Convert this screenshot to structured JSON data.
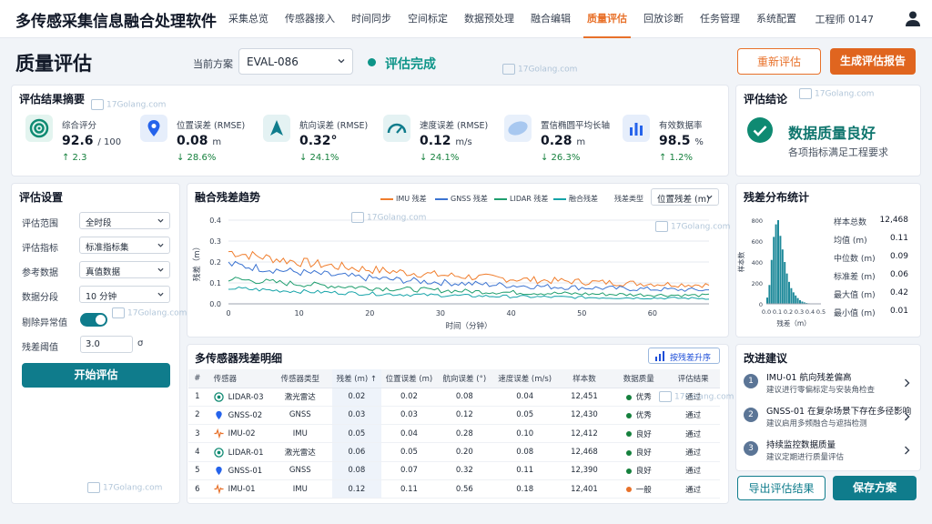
{
  "app": {
    "title": "多传感采集信息融合处理软件",
    "user": "工程师 0147"
  },
  "nav": [
    "采集总览",
    "传感器接入",
    "时间同步",
    "空间标定",
    "数据预处理",
    "融合编辑",
    "质量评估",
    "回放诊断",
    "任务管理",
    "系统配置"
  ],
  "header": {
    "page_title": "质量评估",
    "scheme_label": "当前方案",
    "scheme_value": "EVAL-086",
    "status": "评估完成",
    "reeval_label": "重新评估",
    "report_label": "生成评估报告"
  },
  "summary": {
    "title": "评估结果摘要",
    "metrics": [
      {
        "icon": "target-icon",
        "label": "综合评分",
        "value": "92.6",
        "unit": "/ 100",
        "change": "↑ 2.3"
      },
      {
        "icon": "location-pin-icon",
        "label": "位置误差 (RMSE)",
        "value": "0.08",
        "unit": "m",
        "change": "↓ 28.6%"
      },
      {
        "icon": "heading-arrow-icon",
        "label": "航向误差 (RMSE)",
        "value": "0.32°",
        "unit": "",
        "change": "↓ 24.1%"
      },
      {
        "icon": "speedometer-icon",
        "label": "速度误差 (RMSE)",
        "value": "0.12",
        "unit": "m/s",
        "change": "↓ 24.1%"
      },
      {
        "icon": "ellipse-icon",
        "label": "置信椭圆平均长轴",
        "value": "0.28",
        "unit": "m",
        "change": "↓ 26.3%"
      },
      {
        "icon": "bar-chart-icon",
        "label": "有效数据率",
        "value": "98.5",
        "unit": "%",
        "change": "↑ 1.2%"
      }
    ]
  },
  "conclusion": {
    "title": "评估结论",
    "result": "数据质量良好",
    "detail": "各项指标满足工程要求"
  },
  "settings": {
    "title": "评估设置",
    "fields": [
      {
        "label": "评估范围",
        "value": "全时段"
      },
      {
        "label": "评估指标",
        "value": "标准指标集"
      },
      {
        "label": "参考数据",
        "value": "真值数据"
      },
      {
        "label": "数据分段",
        "value": "10 分钟"
      }
    ],
    "outlier_label": "剔除异常值",
    "threshold_label": "残差阈值",
    "threshold_value": "3.0",
    "threshold_unit": "σ",
    "start_label": "开始评估"
  },
  "trend": {
    "title": "融合残差趋势",
    "residual_type_label": "残差类型",
    "residual_type_value": "位置残差 (m)"
  },
  "chart_data": [
    {
      "type": "line",
      "title": "融合残差趋势",
      "xlabel": "时间（分钟）",
      "ylabel": "残差（m）",
      "xlim": [
        0,
        68
      ],
      "ylim": [
        0,
        0.4
      ],
      "x_ticks": [
        "0",
        "10",
        "20",
        "30",
        "40",
        "50",
        "60"
      ],
      "y_ticks": [
        "0.0",
        "0.1",
        "0.2",
        "0.3",
        "0.4"
      ],
      "series": [
        {
          "name": "IMU 残差",
          "color": "#f07d2c",
          "start": 0.25,
          "end": 0.07,
          "noise": 0.025
        },
        {
          "name": "GNSS 残差",
          "color": "#3b73d1",
          "start": 0.19,
          "end": 0.05,
          "noise": 0.02
        },
        {
          "name": "LIDAR 残差",
          "color": "#1f9e6e",
          "start": 0.12,
          "end": 0.03,
          "noise": 0.015
        },
        {
          "name": "融合残差",
          "color": "#14a3a8",
          "start": 0.075,
          "end": 0.02,
          "noise": 0.01
        }
      ]
    },
    {
      "type": "bar",
      "title": "残差分布统计",
      "xlabel": "残差（m）",
      "ylabel": "样本数",
      "x_ticks": [
        "0.0",
        "0.1",
        "0.2",
        "0.3",
        "0.4",
        "0.5"
      ],
      "y_ticks": [
        "0",
        "200",
        "400",
        "600",
        "800"
      ],
      "bin_width": 0.02,
      "bin_start": 0.0,
      "values": [
        60,
        180,
        420,
        640,
        760,
        800,
        650,
        520,
        400,
        290,
        210,
        150,
        110,
        80,
        55,
        35,
        22,
        14,
        8,
        5,
        3
      ]
    }
  ],
  "distribution": {
    "title": "残差分布统计",
    "stats": [
      {
        "k": "样本总数",
        "v": "12,468"
      },
      {
        "k": "均值 (m)",
        "v": "0.11"
      },
      {
        "k": "中位数 (m)",
        "v": "0.09"
      },
      {
        "k": "标准差 (m)",
        "v": "0.06"
      },
      {
        "k": "最大值 (m)",
        "v": "0.42"
      },
      {
        "k": "最小值 (m)",
        "v": "0.01"
      }
    ]
  },
  "detail": {
    "title": "多传感器残差明细",
    "sort_label": "按残差升序",
    "headers": [
      "#",
      "传感器",
      "传感器类型",
      "残差 (m) ↑",
      "位置误差 (m)",
      "航向误差 (°)",
      "速度误差 (m/s)",
      "样本数",
      "数据质量",
      "评估结果"
    ],
    "rows": [
      {
        "n": "1",
        "icon": "lidar-icon",
        "sensor": "LIDAR-03",
        "type": "激光雷达",
        "res": "0.02",
        "pos": "0.02",
        "hdg": "0.08",
        "spd": "0.04",
        "cnt": "12,451",
        "q": "优秀",
        "qc": "#15803d",
        "r": "通过"
      },
      {
        "n": "2",
        "icon": "gnss-icon",
        "sensor": "GNSS-02",
        "type": "GNSS",
        "res": "0.03",
        "pos": "0.03",
        "hdg": "0.12",
        "spd": "0.05",
        "cnt": "12,430",
        "q": "优秀",
        "qc": "#15803d",
        "r": "通过"
      },
      {
        "n": "3",
        "icon": "imu-icon",
        "sensor": "IMU-02",
        "type": "IMU",
        "res": "0.05",
        "pos": "0.04",
        "hdg": "0.28",
        "spd": "0.10",
        "cnt": "12,412",
        "q": "良好",
        "qc": "#15803d",
        "r": "通过"
      },
      {
        "n": "4",
        "icon": "lidar-icon",
        "sensor": "LIDAR-01",
        "type": "激光雷达",
        "res": "0.06",
        "pos": "0.05",
        "hdg": "0.20",
        "spd": "0.08",
        "cnt": "12,468",
        "q": "良好",
        "qc": "#15803d",
        "r": "通过"
      },
      {
        "n": "5",
        "icon": "gnss-icon",
        "sensor": "GNSS-01",
        "type": "GNSS",
        "res": "0.08",
        "pos": "0.07",
        "hdg": "0.32",
        "spd": "0.11",
        "cnt": "12,390",
        "q": "良好",
        "qc": "#15803d",
        "r": "通过"
      },
      {
        "n": "6",
        "icon": "imu-icon",
        "sensor": "IMU-01",
        "type": "IMU",
        "res": "0.12",
        "pos": "0.11",
        "hdg": "0.56",
        "spd": "0.18",
        "cnt": "12,401",
        "q": "一般",
        "qc": "#e8712a",
        "r": "通过"
      }
    ]
  },
  "suggestions": {
    "title": "改进建议",
    "items": [
      {
        "n": "1",
        "t": "IMU-01 航向残差偏高",
        "s": "建议进行零偏标定与安装角检查"
      },
      {
        "n": "2",
        "t": "GNSS-01 在复杂场景下存在多径影响",
        "s": "建议启用多频融合与遮挡检测"
      },
      {
        "n": "3",
        "t": "持续监控数据质量",
        "s": "建议定期进行质量评估"
      }
    ],
    "export_label": "导出评估结果",
    "save_label": "保存方案"
  },
  "watermark": "17Golang.com"
}
